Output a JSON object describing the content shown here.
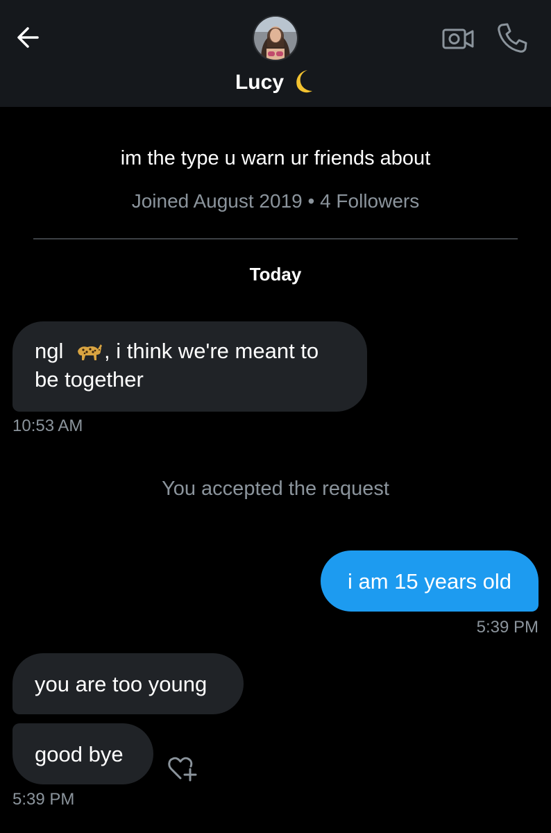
{
  "header": {
    "name": "Lucy",
    "name_emoji": "crescent-moon",
    "back_icon": "arrow-left-icon",
    "video_icon": "video-camera-icon",
    "call_icon": "phone-icon"
  },
  "profile": {
    "bio": "im the type u warn ur friends about",
    "meta": "Joined August 2019 • 4 Followers"
  },
  "conversation": {
    "day_label": "Today",
    "messages": [
      {
        "direction": "incoming",
        "before_emoji": "ngl ",
        "emoji": "leopard",
        "after_emoji": ", i think we're meant to be together",
        "time": "10:53 AM"
      },
      {
        "direction": "incoming",
        "text": "i am 15 years old",
        "time": "5:39 PM"
      },
      {
        "direction": "incoming",
        "text": "you are too young"
      },
      {
        "direction": "incoming",
        "text": "good bye",
        "time": "5:39 PM"
      }
    ],
    "system_message": "You accepted the request"
  },
  "colors": {
    "background": "#000000",
    "header_bg": "#15181c",
    "incoming_bubble": "#202327",
    "outgoing_bubble": "#1d9bf0",
    "secondary_text": "#8b949c",
    "divider": "#3d4145"
  }
}
